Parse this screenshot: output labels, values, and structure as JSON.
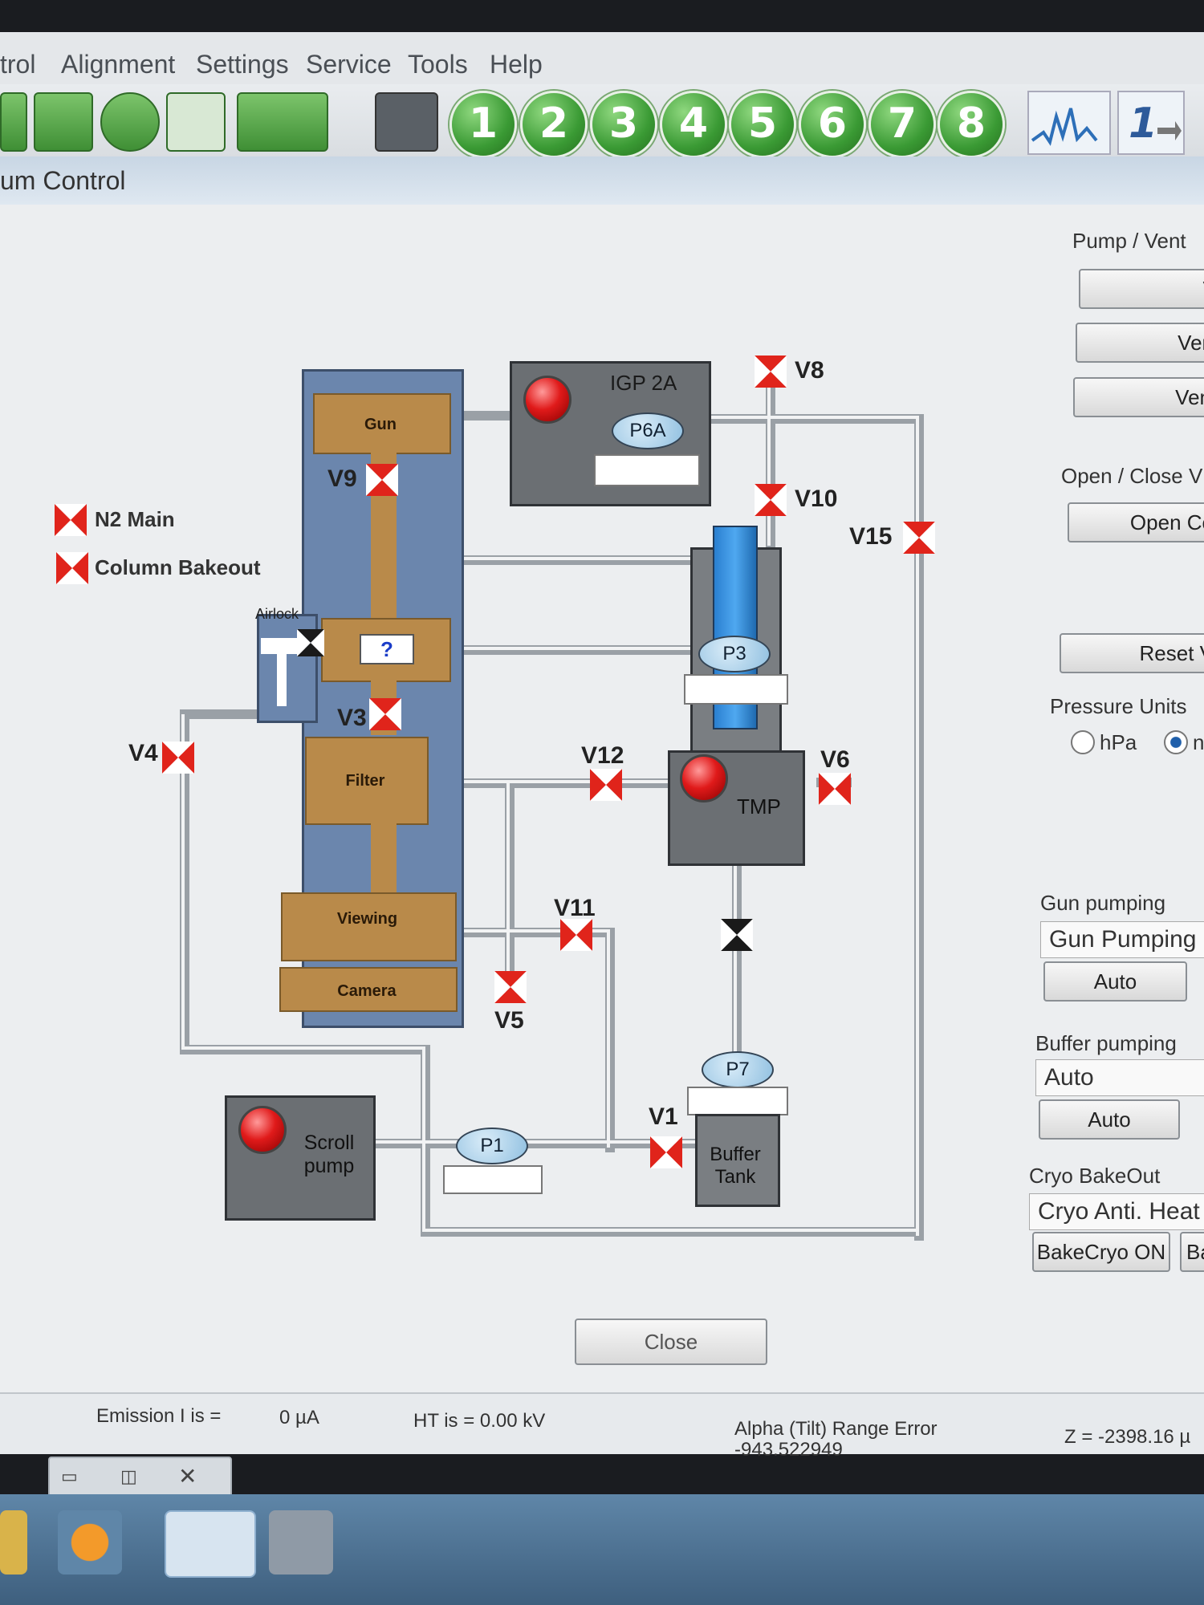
{
  "menu": [
    "trol",
    "Alignment",
    "Settings",
    "Service",
    "Tools",
    "Help"
  ],
  "toolbar": {
    "numbers": [
      "1",
      "2",
      "3",
      "4",
      "5",
      "6",
      "7",
      "8"
    ]
  },
  "window_title": "um Control",
  "diagram": {
    "labels": {
      "gun": "Gun",
      "filter": "Filter",
      "viewing": "Viewing",
      "camera": "Camera",
      "airlock": "Airlock",
      "question": "?",
      "igp": "IGP 2A",
      "tmp": "TMP",
      "scroll": "Scroll\npump",
      "buffer": "Buffer\nTank"
    },
    "pumps": {
      "p6a": "P6A",
      "p3": "P3",
      "p7": "P7",
      "p1": "P1"
    },
    "valves": {
      "v1": "V1",
      "v3": "V3",
      "v4": "V4",
      "v5": "V5",
      "v6": "V6",
      "v8": "V8",
      "v9": "V9",
      "v10": "V10",
      "v11": "V11",
      "v12": "V12",
      "v15": "V15"
    },
    "legend": {
      "n2": "N2 Main",
      "bakeout": "Column Bakeout"
    }
  },
  "right_panel": {
    "pump_vent": {
      "label": "Pump / Vent",
      "buttons": [
        "V",
        "Ven",
        "Ven"
      ]
    },
    "open_close": {
      "label": "Open / Close V",
      "button": "Open Co"
    },
    "reset": "Reset V",
    "pressure_units": {
      "label": "Pressure Units",
      "opt1": "hPa",
      "opt2": "n"
    },
    "gun_pumping": {
      "label": "Gun pumping",
      "value": "Gun Pumping",
      "button": "Auto"
    },
    "buffer_pumping": {
      "label": "Buffer pumping",
      "value": "Auto",
      "button": "Auto"
    },
    "cryo": {
      "label": "Cryo BakeOut",
      "value": "Cryo Anti. Heat",
      "button": "BakeCryo ON",
      "button2": "Ba"
    }
  },
  "close_button": "Close",
  "status": {
    "emission_label": "Emission I is  =",
    "emission_value": "0 µA",
    "ht": "HT is =  0.00 kV",
    "alpha_error": "Alpha (Tilt) Range Error",
    "alpha_value": "-943.522949",
    "z": "Z = -2398.16 µ"
  },
  "colors": {
    "valve_red": "#e0241b",
    "column_blue": "#6b86ad",
    "chamber_brown": "#b98a4a"
  }
}
